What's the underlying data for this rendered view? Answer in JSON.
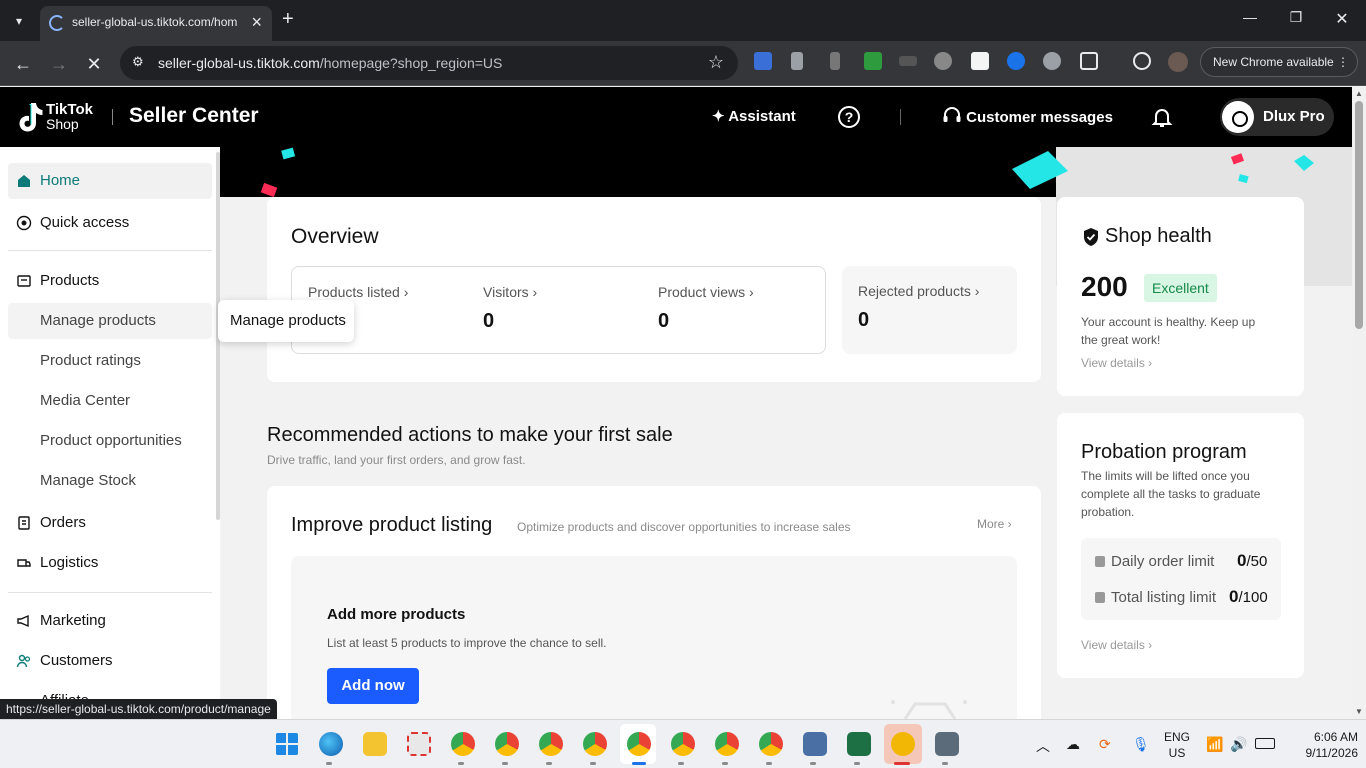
{
  "browser": {
    "tab_title": "seller-global-us.tiktok.com/hom",
    "url_host": "seller-global-us.tiktok.com",
    "url_path": "/homepage?shop_region=US",
    "update_label": "New Chrome available",
    "status_url": "https://seller-global-us.tiktok.com/product/manage"
  },
  "header": {
    "logo_line1": "TikTok",
    "logo_line2": "Shop",
    "title": "Seller Center",
    "assistant": "Assistant",
    "messages": "Customer messages",
    "account_name": "Dlux Pro"
  },
  "sidebar": {
    "home": "Home",
    "quick_access": "Quick access",
    "products": "Products",
    "manage_products": "Manage products",
    "product_ratings": "Product ratings",
    "media_center": "Media Center",
    "product_opportunities": "Product opportunities",
    "manage_stock": "Manage Stock",
    "orders": "Orders",
    "logistics": "Logistics",
    "marketing": "Marketing",
    "customers": "Customers",
    "affiliate": "Affiliate"
  },
  "tooltip": "Manage products",
  "overview": {
    "title": "Overview",
    "products_listed": "Products listed ›",
    "visitors": "Visitors ›",
    "visitors_value": "0",
    "product_views": "Product views ›",
    "product_views_value": "0",
    "rejected": "Rejected products ›",
    "rejected_value": "0"
  },
  "recommended": {
    "title": "Recommended actions to make your first sale",
    "subtitle": "Drive traffic, land your first orders, and grow fast.",
    "card_title": "Improve product listing",
    "card_subtitle": "Optimize products and discover opportunities to increase sales",
    "more": "More ›",
    "task_title": "Add more products",
    "task_desc": "List at least 5 products to improve the chance to sell.",
    "task_button": "Add now"
  },
  "shop_health": {
    "title": "Shop health",
    "score": "200",
    "badge": "Excellent",
    "desc_line1": "Your account is healthy. Keep up",
    "desc_line2": "the great work!",
    "link": "View details ›"
  },
  "probation": {
    "title": "Probation program",
    "desc_line1": "The limits will be lifted once you",
    "desc_line2": "complete all the tasks to graduate",
    "desc_line3": "probation.",
    "daily_label": "Daily order limit",
    "daily_used": "0",
    "daily_total": "/50",
    "total_label": "Total listing limit",
    "total_used": "0",
    "total_total": "/100",
    "link": "View details ›"
  },
  "taskbar": {
    "lang_line1": "ENG",
    "lang_line2": "US",
    "time": "6:06 AM",
    "date": "9/11/2026"
  },
  "colors": {
    "accent_teal": "#0b7a78",
    "primary_blue": "#1a5cff",
    "excellent_green": "#168a49",
    "confetti_cyan": "#25e6e6",
    "confetti_pink": "#fe2c55"
  }
}
